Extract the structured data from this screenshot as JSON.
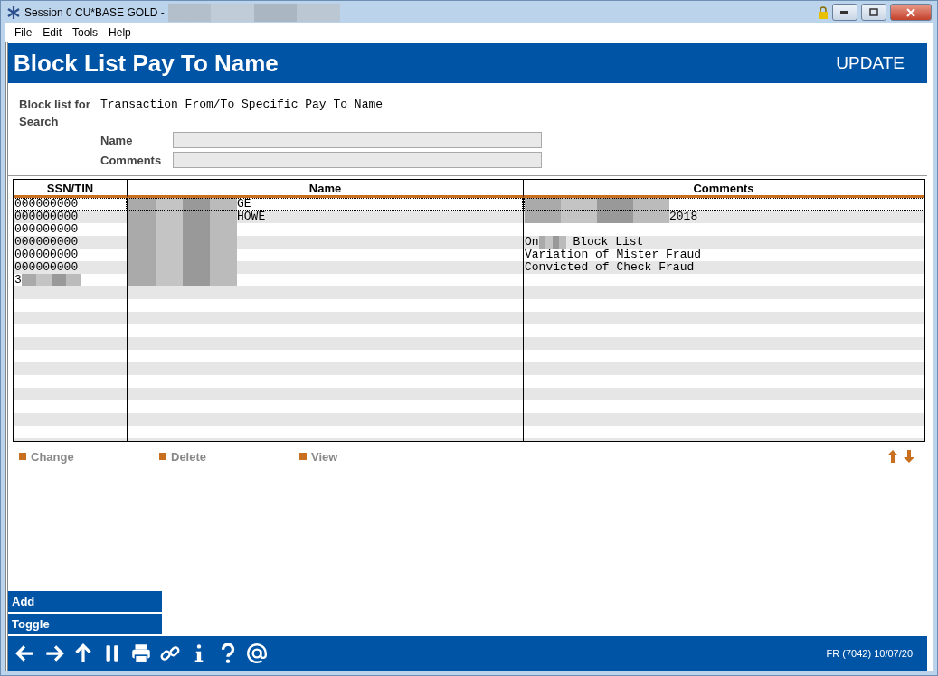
{
  "window": {
    "title": "Session 0 CU*BASE GOLD -"
  },
  "menu": [
    "File",
    "Edit",
    "Tools",
    "Help"
  ],
  "header": {
    "title": "Block List Pay To Name",
    "mode": "UPDATE"
  },
  "block_list_for": {
    "label": "Block list for",
    "value": "Transaction From/To Specific Pay To Name"
  },
  "search": {
    "label": "Search",
    "fields": [
      {
        "label": "Name"
      },
      {
        "label": "Comments"
      }
    ]
  },
  "table": {
    "columns": [
      "SSN/TIN",
      "Name",
      "Comments"
    ],
    "rows": [
      {
        "selected": true,
        "cells": [
          {
            "text": "000000000",
            "redacted": false
          },
          {
            "text": "GE",
            "redacted": true
          },
          {
            "text": "",
            "redacted": true
          }
        ]
      },
      {
        "selected": false,
        "cells": [
          {
            "text": "000000000",
            "redacted": false
          },
          {
            "text": "HOWE",
            "redacted": true
          },
          {
            "text": "2018",
            "redacted": true
          }
        ]
      },
      {
        "selected": false,
        "cells": [
          {
            "text": "000000000",
            "redacted": false
          },
          {
            "text": "",
            "redacted": true
          },
          {
            "text": "",
            "redacted": false
          }
        ]
      },
      {
        "selected": false,
        "cells": [
          {
            "text": "000000000",
            "redacted": false
          },
          {
            "text": "",
            "redacted": true
          },
          {
            "text": "On",
            "redacted": false
          },
          {
            "text": "Block List",
            "redacted": true
          }
        ]
      },
      {
        "selected": false,
        "cells": [
          {
            "text": "000000000",
            "redacted": false
          },
          {
            "text": "",
            "redacted": true
          },
          {
            "text": "Variation of Mister Fraud",
            "redacted": false
          }
        ]
      },
      {
        "selected": false,
        "cells": [
          {
            "text": "000000000",
            "redacted": false
          },
          {
            "text": "",
            "redacted": true
          },
          {
            "text": "Convicted of Check Fraud",
            "redacted": false
          }
        ]
      },
      {
        "selected": false,
        "cells": [
          {
            "text": "3",
            "redacted": true
          },
          {
            "text": "",
            "redacted": true
          },
          {
            "text": "",
            "redacted": false
          }
        ]
      }
    ]
  },
  "actions": [
    "Change",
    "Delete",
    "View"
  ],
  "side_buttons": [
    "Add",
    "Toggle"
  ],
  "status": "FR (7042) 10/07/20"
}
